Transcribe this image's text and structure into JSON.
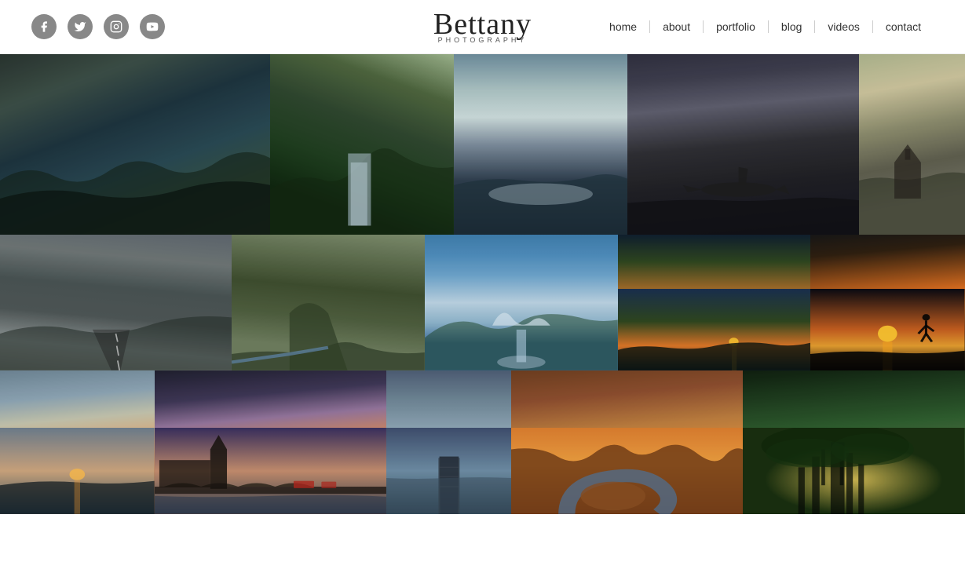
{
  "header": {
    "logo": {
      "script": "Bettany",
      "sub": "PHOTOGRAPHY"
    },
    "social": [
      {
        "name": "facebook",
        "icon": "f"
      },
      {
        "name": "twitter",
        "icon": "t"
      },
      {
        "name": "instagram",
        "icon": "i"
      },
      {
        "name": "youtube",
        "icon": "▶"
      }
    ],
    "nav": [
      {
        "label": "home",
        "id": "home"
      },
      {
        "label": "about",
        "id": "about"
      },
      {
        "label": "portfolio",
        "id": "portfolio"
      },
      {
        "label": "blog",
        "id": "blog"
      },
      {
        "label": "videos",
        "id": "videos"
      },
      {
        "label": "contact",
        "id": "contact"
      }
    ]
  },
  "gallery": {
    "rows": [
      {
        "id": "row1",
        "photos": [
          {
            "id": "r1p1",
            "alt": "Coastal cliffs Iceland",
            "class": "r1p1-inner"
          },
          {
            "id": "r1p2",
            "alt": "Waterfall Iceland",
            "class": "r1p2-inner"
          },
          {
            "id": "r1p3",
            "alt": "Ice lake reflection Iceland",
            "class": "r1p3-inner"
          },
          {
            "id": "r1p4",
            "alt": "Plane wreck black sand beach Iceland",
            "class": "r1p4-inner"
          },
          {
            "id": "r1p5",
            "alt": "Church Iceland",
            "class": "r1p5-inner"
          }
        ]
      },
      {
        "id": "row2",
        "photos": [
          {
            "id": "r2p1",
            "alt": "Mountain road Iceland",
            "class": "r2p1-inner"
          },
          {
            "id": "r2p2",
            "alt": "Kirkjufell mountain Iceland",
            "class": "r2p2-inner"
          },
          {
            "id": "r2p3",
            "alt": "Glacier valley waterfall Iceland",
            "class": "r2p3-inner"
          },
          {
            "id": "r2p4",
            "alt": "Sunset coast Iceland",
            "class": "r2p4-inner"
          },
          {
            "id": "r2p5",
            "alt": "Silhouette sunset Iceland",
            "class": "r2p5-inner"
          }
        ]
      },
      {
        "id": "row3",
        "photos": [
          {
            "id": "r3p1",
            "alt": "Sunset ocean Iceland",
            "class": "r3p1-inner"
          },
          {
            "id": "r3p2",
            "alt": "London Westminster Bridge",
            "class": "r3p2-inner"
          },
          {
            "id": "r3p3",
            "alt": "Pier long exposure",
            "class": "r3p3-inner"
          },
          {
            "id": "r3p4",
            "alt": "Horseshoe Bend Arizona",
            "class": "r3p4-inner"
          },
          {
            "id": "r3p5",
            "alt": "Banyan tree forest",
            "class": "r3p5-inner"
          }
        ]
      }
    ]
  }
}
